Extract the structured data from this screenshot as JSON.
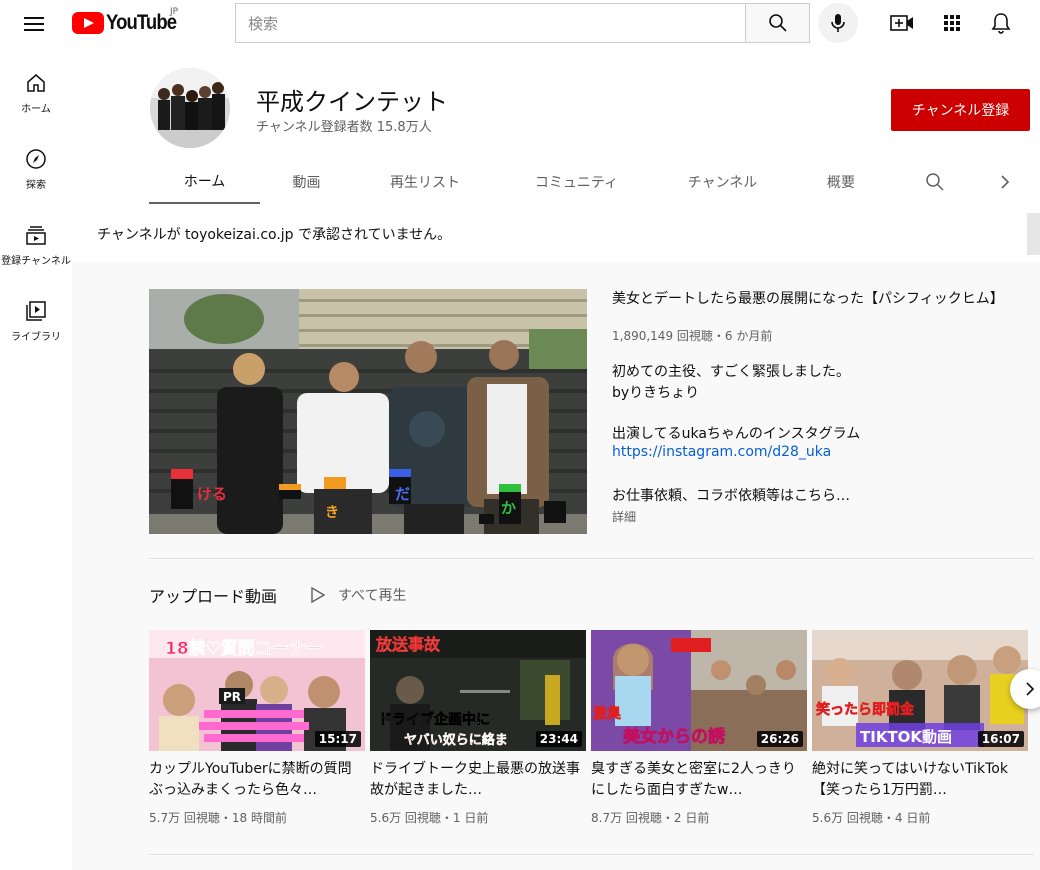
{
  "header": {
    "logo_text": "YouTube",
    "logo_region": "JP",
    "search_placeholder": "検索"
  },
  "sidebar": {
    "items": [
      {
        "label": "ホーム",
        "icon": "home-icon"
      },
      {
        "label": "探索",
        "icon": "explore-icon"
      },
      {
        "label": "登録チャンネル",
        "icon": "subscriptions-icon"
      },
      {
        "label": "ライブラリ",
        "icon": "library-icon"
      }
    ]
  },
  "channel": {
    "name": "平成クインテット",
    "subscribers": "チャンネル登録者数 15.8万人",
    "subscribe_label": "チャンネル登録",
    "tabs": [
      "ホーム",
      "動画",
      "再生リスト",
      "コミュニティ",
      "チャンネル",
      "概要"
    ],
    "notice": "チャンネルが toyokeizai.co.jp で承認されていません。"
  },
  "featured": {
    "title": "美女とデートしたら最悪の展開になった【パシフィックヒム】",
    "meta": "1,890,149 回視聴・6 か月前",
    "desc_line1": "初めての主役、すごく緊張しました。",
    "desc_line2": "byりきちょり",
    "desc_line3": "出演してるukaちゃんのインスタグラム",
    "link": "https://instagram.com/d28_uka",
    "desc_line4": "お仕事依頼、コラボ依頼等はこちら…",
    "more": "詳細",
    "caption_chars": [
      "ける",
      "き",
      "だ",
      "か"
    ]
  },
  "uploads": {
    "title": "アップロード動画",
    "play_all": "すべて再生",
    "videos": [
      {
        "title": "カップルYouTuberに禁断の質問ぶっ込みまくったら色々…",
        "meta": "5.7万 回視聴・18 時間前",
        "duration": "15:17",
        "overlay_top": "18禁♡質問コーナー",
        "overlay_bottom": "PR",
        "bg": "#f0b9c8"
      },
      {
        "title": "ドライブトーク史上最悪の放送事故が起きました…",
        "meta": "5.6万 回視聴・1 日前",
        "duration": "23:44",
        "overlay_top": "放送事故",
        "overlay_bottom": "ドライブ企画中に",
        "overlay_bottom2": "ヤバい奴らに絡ま",
        "bg": "#2b2f2a"
      },
      {
        "title": "臭すぎる美女と密室に2人っきりにしたら面白すぎたw…",
        "meta": "8.7万 回視聴・2 日前",
        "duration": "26:26",
        "overlay_top": "激臭",
        "overlay_bottom": "美女からの誘",
        "bg": "#7d4fa8"
      },
      {
        "title": "絶対に笑ってはいけないTikTok【笑ったら1万円罰…",
        "meta": "5.6万 回視聴・4 日前",
        "duration": "16:07",
        "overlay_top": "笑ったら即罰金",
        "overlay_bottom": "TIKTOK動画",
        "bg": "#c9a38a"
      }
    ]
  },
  "colors": {
    "brand_red": "#ff0000",
    "subscribe_red": "#cc0000",
    "link_blue": "#065fd4"
  }
}
